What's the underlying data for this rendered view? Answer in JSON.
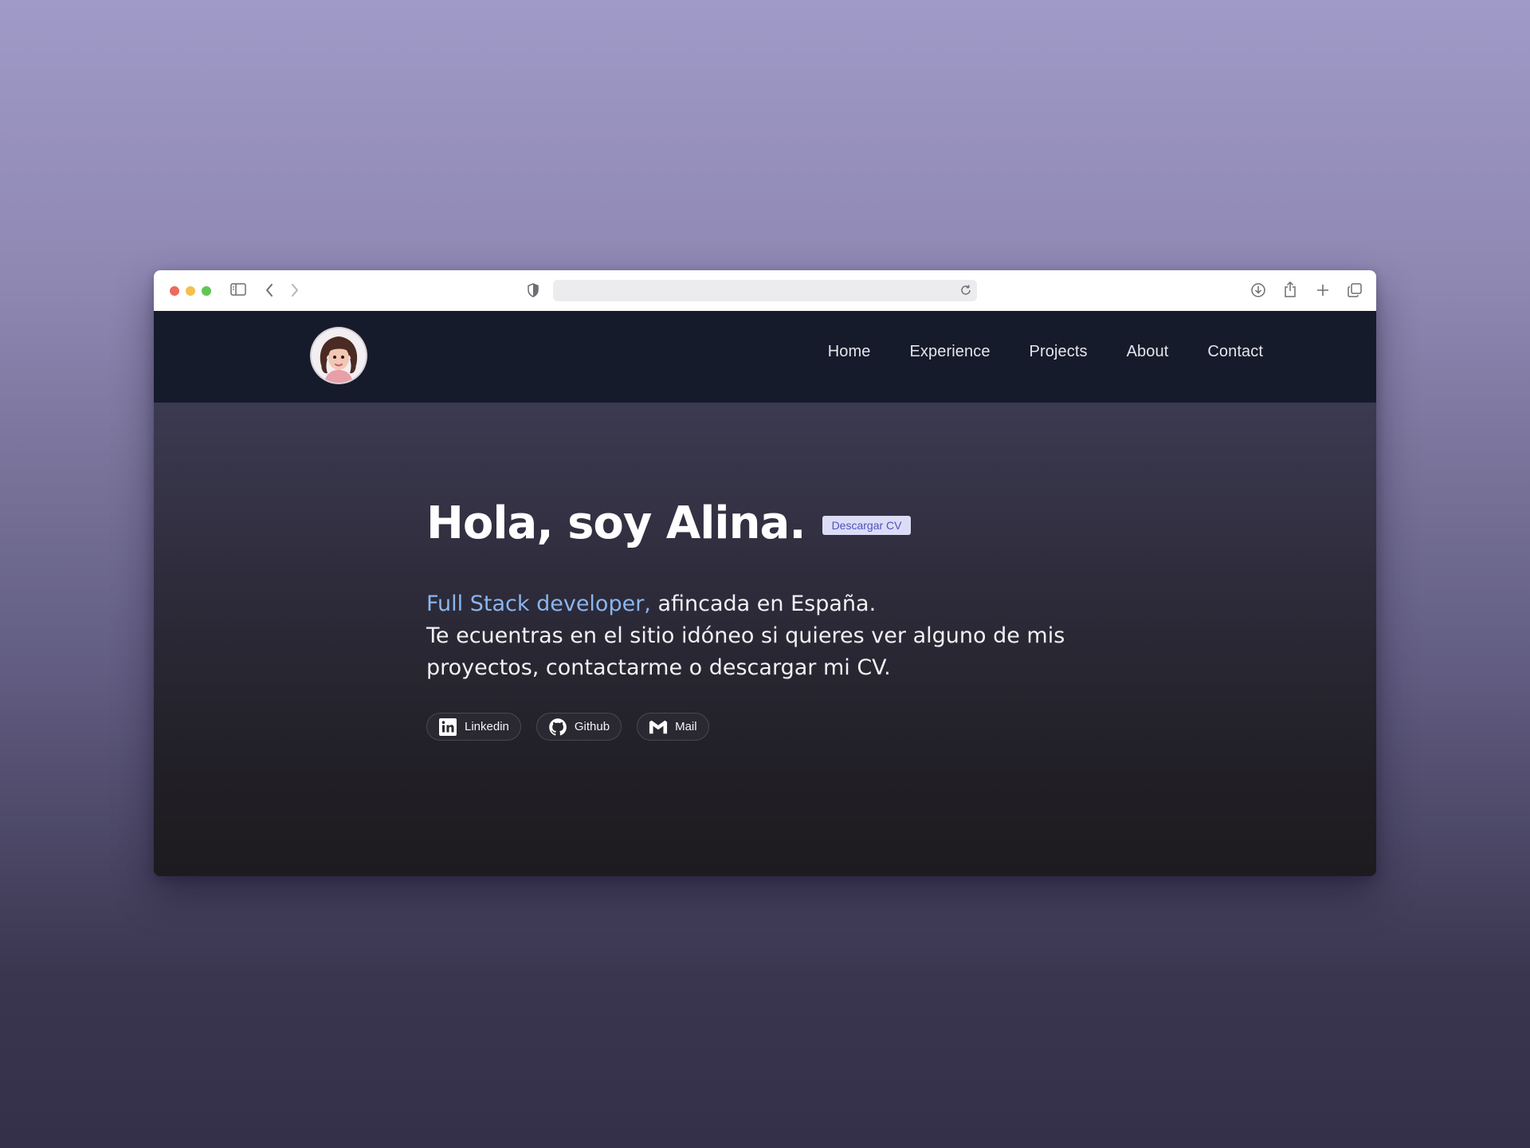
{
  "browser": {
    "icons": [
      "sidebar-icon",
      "back-icon",
      "forward-icon",
      "shield-icon",
      "reload-icon",
      "download-icon",
      "share-icon",
      "new-tab-icon",
      "tabs-overview-icon"
    ],
    "url_value": ""
  },
  "nav": {
    "links": [
      "Home",
      "Experience",
      "Projects",
      "About",
      "Contact"
    ]
  },
  "hero": {
    "title": "Hola, soy Alina.",
    "cv_button": "Descargar CV",
    "role": "Full Stack developer,",
    "location": " afincada en España.",
    "line2": "Te ecuentras en el sitio idóneo si quieres ver alguno de mis proyectos, contactarme o descargar mi CV."
  },
  "socials": [
    {
      "label": "Linkedin",
      "icon": "linkedin-icon"
    },
    {
      "label": "Github",
      "icon": "github-icon"
    },
    {
      "label": "Mail",
      "icon": "gmail-icon"
    }
  ],
  "colors": {
    "accent": "#8ab6ee",
    "nav_bg": "#161b2b",
    "badge_bg": "#dcdcf7",
    "badge_text": "#4d52b8"
  }
}
